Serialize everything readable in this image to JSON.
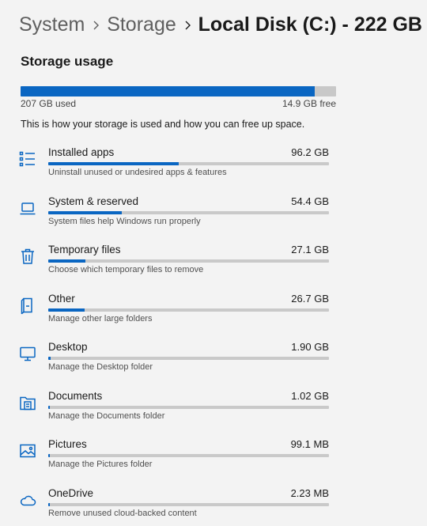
{
  "breadcrumb": {
    "items": [
      "System",
      "Storage"
    ],
    "current": "Local Disk (C:) - 222 GB"
  },
  "storage_usage": {
    "title": "Storage usage",
    "used_label": "207 GB used",
    "free_label": "14.9 GB free",
    "used_fraction": 0.933,
    "description": "This is how your storage is used and how you can free up space."
  },
  "categories": [
    {
      "name": "Installed apps",
      "size": "96.2 GB",
      "description": "Uninstall unused or undesired apps & features",
      "fraction": 0.465,
      "icon": "installed-apps-icon"
    },
    {
      "name": "System & reserved",
      "size": "54.4 GB",
      "description": "System files help Windows run properly",
      "fraction": 0.263,
      "icon": "laptop-icon"
    },
    {
      "name": "Temporary files",
      "size": "27.1 GB",
      "description": "Choose which temporary files to remove",
      "fraction": 0.131,
      "icon": "trash-icon"
    },
    {
      "name": "Other",
      "size": "26.7 GB",
      "description": "Manage other large folders",
      "fraction": 0.129,
      "icon": "other-files-icon"
    },
    {
      "name": "Desktop",
      "size": "1.90 GB",
      "description": "Manage the Desktop folder",
      "fraction": 0.009,
      "icon": "desktop-icon"
    },
    {
      "name": "Documents",
      "size": "1.02 GB",
      "description": "Manage the Documents folder",
      "fraction": 0.005,
      "icon": "documents-icon"
    },
    {
      "name": "Pictures",
      "size": "99.1 MB",
      "description": "Manage the Pictures folder",
      "fraction": 0.002,
      "icon": "pictures-icon"
    },
    {
      "name": "OneDrive",
      "size": "2.23 MB",
      "description": "Remove unused cloud-backed content",
      "fraction": 0.001,
      "icon": "cloud-icon"
    }
  ],
  "colors": {
    "accent": "#0a66c2",
    "track": "#c9c9c9",
    "background": "#f3f3f3"
  }
}
